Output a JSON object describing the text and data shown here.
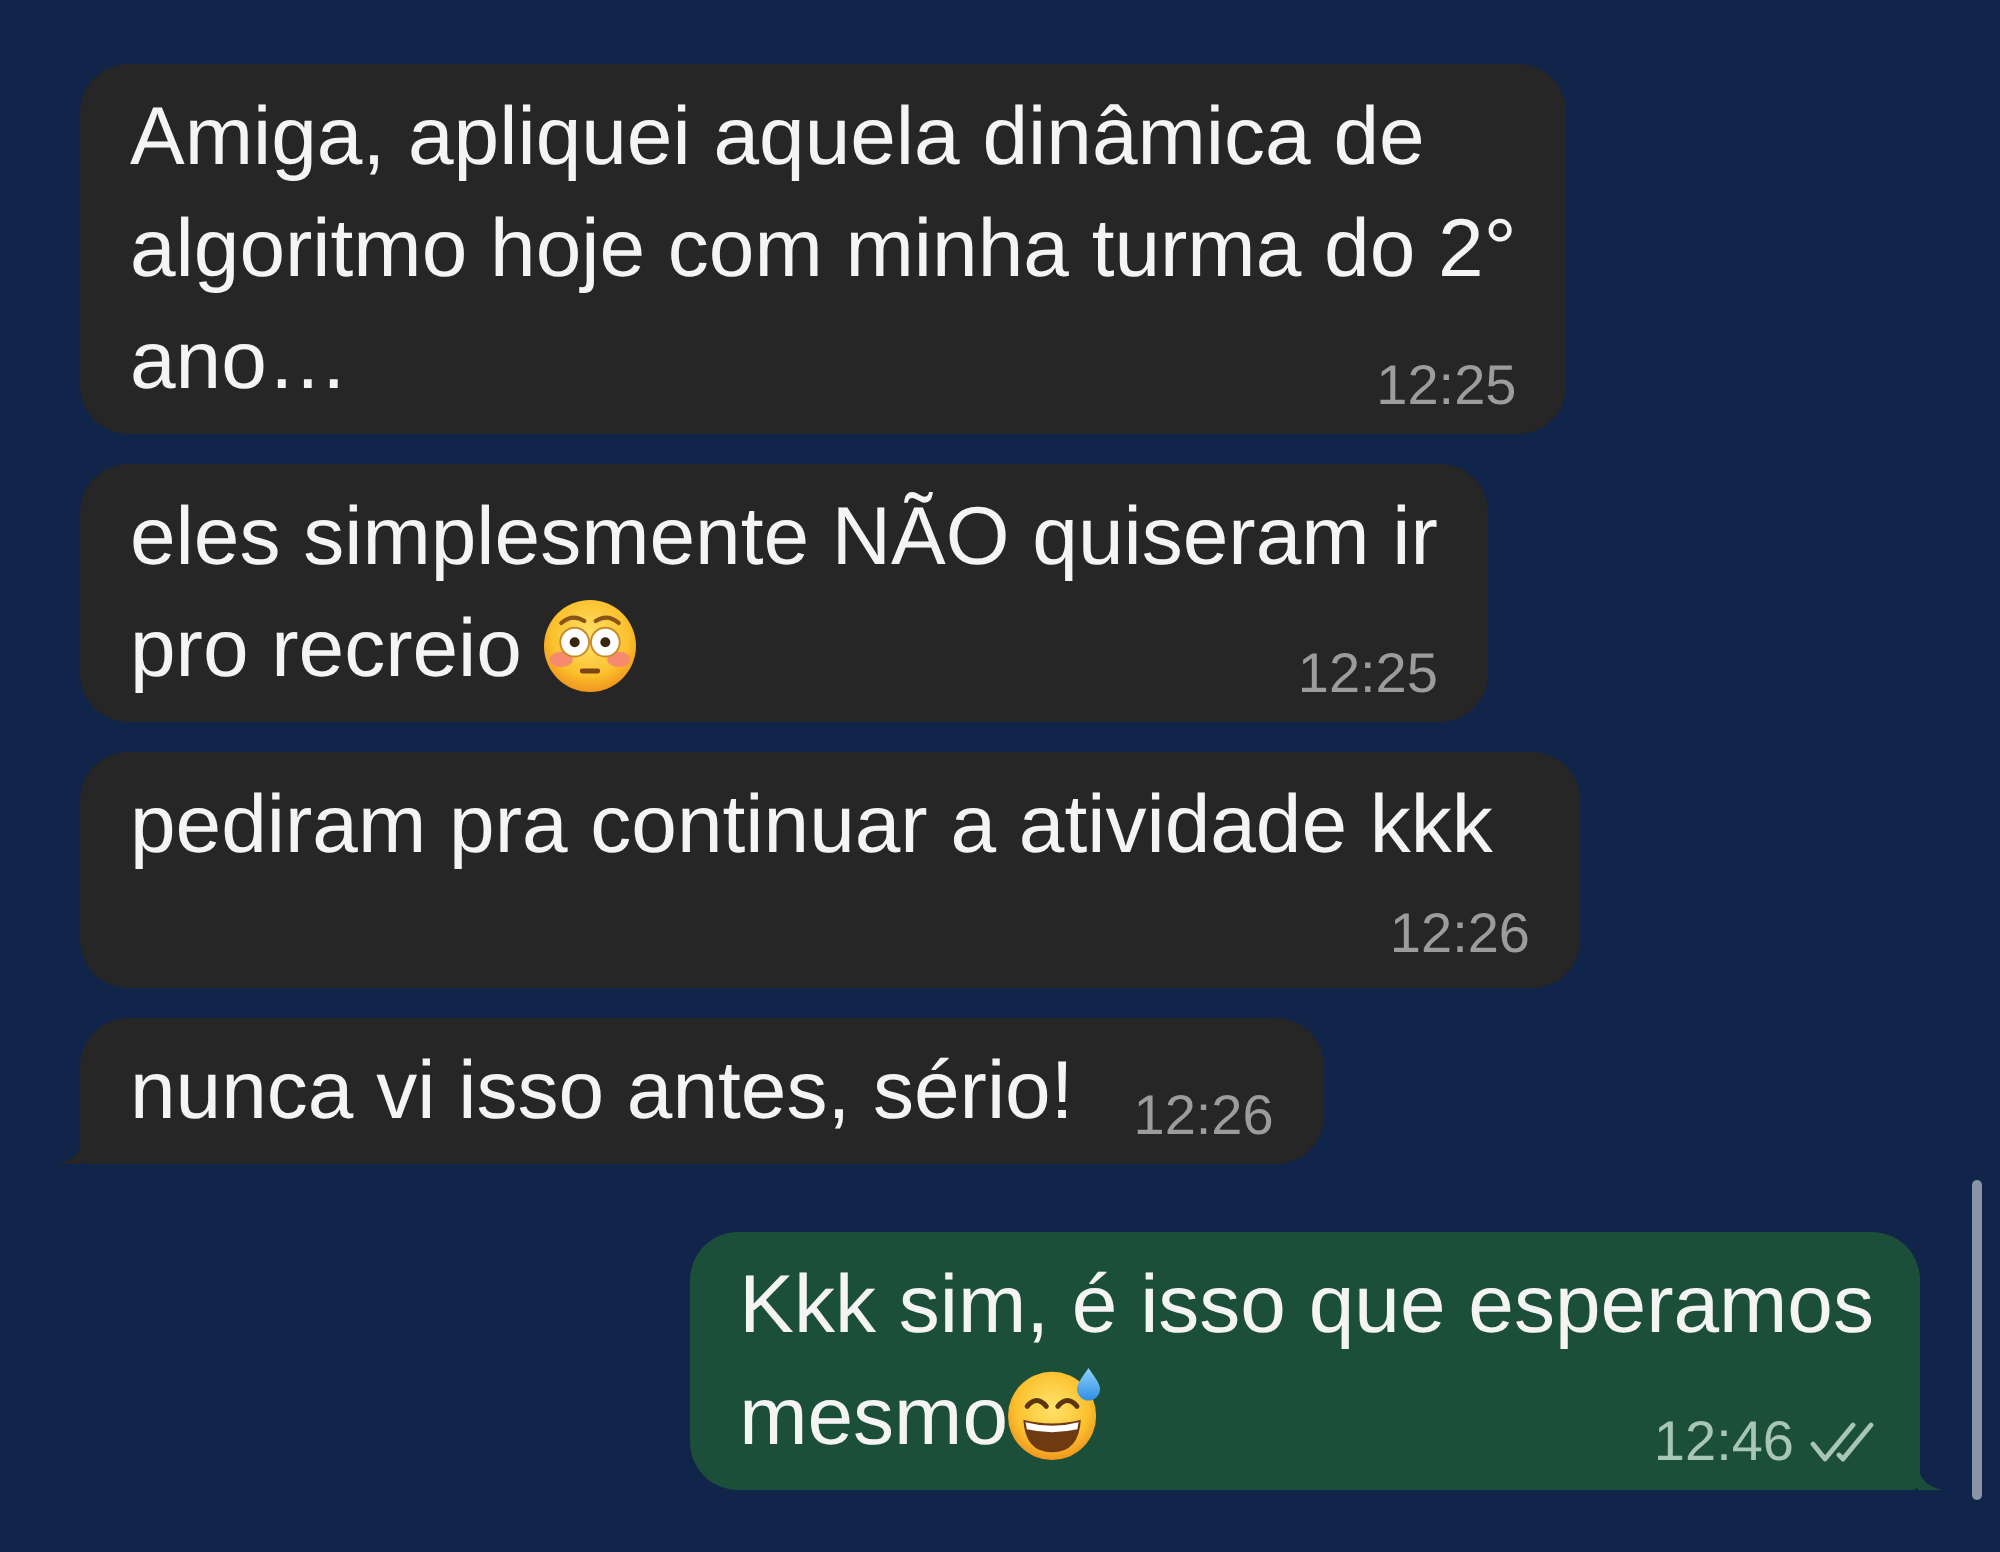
{
  "chat": {
    "messages": [
      {
        "kind": "incoming",
        "lines": [
          "Amiga, apliquei aquela dinâmica de",
          "algoritmo hoje com minha turma do 2°",
          "ano…"
        ],
        "time": "12:25",
        "tail": false
      },
      {
        "kind": "incoming",
        "lines": [
          "eles simplesmente NÃO quiseram ir",
          "pro recreio "
        ],
        "emoji": {
          "kind": "flushed"
        },
        "time": "12:25",
        "tail": false
      },
      {
        "kind": "incoming",
        "lines": [
          "pediram pra continuar a atividade kkk"
        ],
        "time": "12:26",
        "tail": false
      },
      {
        "kind": "incoming",
        "lines": [
          "nunca vi isso antes, sério!"
        ],
        "time": "12:26",
        "tail": true
      },
      {
        "kind": "outgoing",
        "lines": [
          "Kkk sim, é isso que esperamos",
          "mesmo"
        ],
        "emoji": {
          "kind": "sweat-smile"
        },
        "time": "12:46",
        "read": false,
        "tail": true
      }
    ]
  }
}
